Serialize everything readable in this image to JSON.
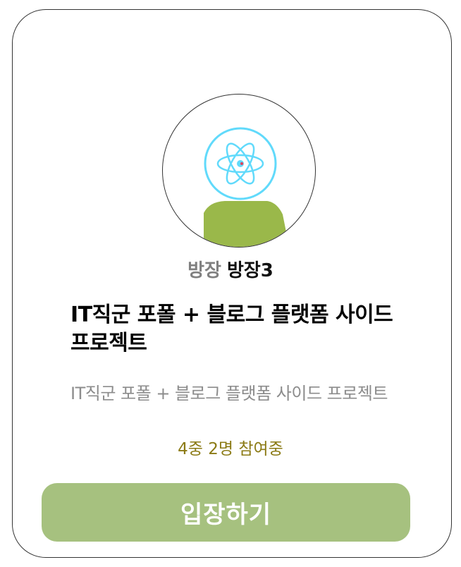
{
  "room_card": {
    "avatar": {
      "icon": "react-atom-icon",
      "icon_color": "#61dafb",
      "body_color": "#9ab84a"
    },
    "host_label": "방장",
    "host_name": "방장3",
    "title": "IT직군 포폴 + 블로그 플랫폼 사이드 프로젝트",
    "description": "IT직군 포폴 + 블로그 플랫폼 사이드 프로젝트",
    "participants": "4중 2명 참여중",
    "enter_button_label": "입장하기",
    "colors": {
      "button": "#a6c17f",
      "participants_text": "#8b7a14",
      "border": "#333333"
    }
  }
}
